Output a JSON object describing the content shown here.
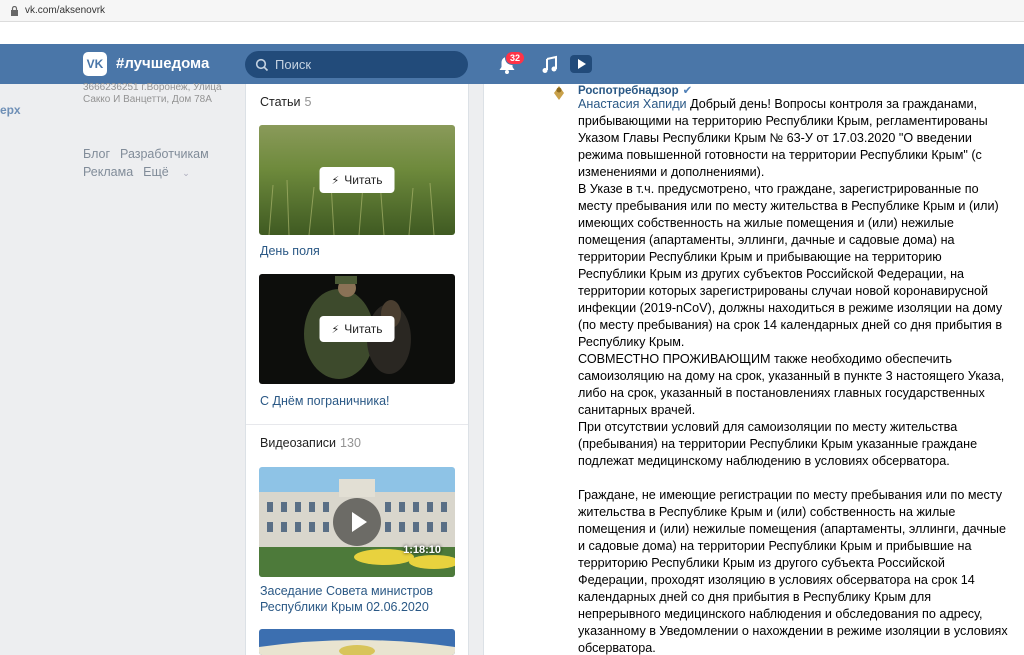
{
  "browser": {
    "url": "vk.com/aksenovrk"
  },
  "header": {
    "logo": "VK",
    "brand": "#лучшедома",
    "search_placeholder": "Поиск",
    "notifications_count": "32"
  },
  "left": {
    "up_label": "ерх",
    "address": "3666236251 г.Воронеж, Улица Сакко И Ванцетти, Дом 78А",
    "links": [
      "Блог",
      "Разработчикам",
      "Реклама",
      "Ещё"
    ]
  },
  "articles": {
    "title": "Статьи",
    "count": "5",
    "items": [
      {
        "read_label": "Читать",
        "title": "День поля"
      },
      {
        "read_label": "Читать",
        "title": "С Днём пограничника!"
      }
    ]
  },
  "videos": {
    "title": "Видеозаписи",
    "count": "130",
    "items": [
      {
        "duration": "1:18:10",
        "title": "Заседание Совета министров Республики Крым 02.06.2020"
      }
    ]
  },
  "post": {
    "author": "Роспотребнадзор",
    "mention": "Анастасия Хапиди",
    "paragraphs": [
      "Добрый день! Вопросы контроля за гражданами, прибывающими на территорию Республики Крым, регламентированы Указом Главы Республики Крым № 63-У от 17.03.2020 \"О введении режима повышенной готовности на территории Республики Крым\" (с изменениями и дополнениями).",
      "В Указе в т.ч. предусмотрено, что граждане, зарегистрированные по месту пребывания или по месту жительства в Республике Крым и (или) имеющих собственность на жилые помещения и (или) нежилые помещения (апартаменты, эллинги, дачные и садовые дома) на территории Республики Крым и прибывающие на территорию Республики Крым из других субъектов Российской Федерации, на территории которых зарегистрированы случаи новой коронавирусной инфекции (2019-nCoV), должны находиться в режиме изоляции на дому (по месту пребывания) на срок 14 календарных дней со дня прибытия в Республику Крым.",
      "СОВМЕСТНО ПРОЖИВАЮЩИМ также необходимо обеспечить самоизоляцию на дому на срок, указанный в пункте 3 настоящего Указа, либо на срок, указанный в постановлениях главных государственных санитарных врачей.",
      "При отсутствии условий для самоизоляции по месту жительства (пребывания) на территории Республики Крым указанные граждане подлежат медицинскому наблюдению в условиях обсерватора.",
      "Граждане, не имеющие регистрации по месту пребывания или по месту жительства в Республике Крым и (или) собственность на жилые помещения и (или) нежилые помещения (апартаменты, эллинги, дачные и садовые дома) на территории Республики Крым и прибывшие на территорию Республики Крым из другого субъекта Российской Федерации, проходят изоляцию в условиях обсерватора на срок 14 календарных дней со дня прибытия в Республику Крым для непрерывного медицинского наблюдения и обследования по адресу, указанному в Уведомлении о нахождении в режиме изоляции в условиях обсерватора."
    ]
  },
  "colors": {
    "header": "#4a76a8",
    "link": "#2a5885",
    "badge": "#ff3347"
  },
  "icons": [
    "lock-icon",
    "vk-logo-icon",
    "search-icon",
    "bell-icon",
    "music-icon",
    "video-icon",
    "verified-icon",
    "lightning-icon",
    "play-icon"
  ]
}
